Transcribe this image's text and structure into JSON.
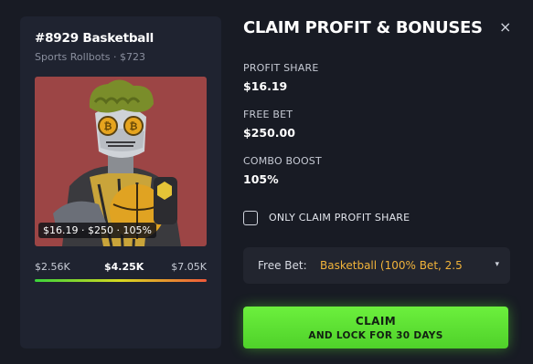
{
  "nft_card": {
    "title": "#8929 Basketball",
    "subtitle": "Sports Rollbots · $723",
    "image_badge": "$16.19 · $250 · 105%",
    "scale": {
      "low": "$2.56K",
      "mid": "$4.25K",
      "high": "$7.05K"
    },
    "colors": {
      "art_background": "#9c4545",
      "gradient_start": "#3bd43b",
      "gradient_mid": "#d8d820",
      "gradient_end": "#f05a3a"
    }
  },
  "dialog": {
    "title": "CLAIM PROFIT & BONUSES",
    "close_icon": "×",
    "profit_share": {
      "label": "PROFIT SHARE",
      "value": "$16.19"
    },
    "free_bet": {
      "label": "FREE BET",
      "value": "$250.00"
    },
    "combo_boost": {
      "label": "COMBO BOOST",
      "value": "105%"
    },
    "only_profit_checkbox": {
      "label": "ONLY CLAIM PROFIT SHARE",
      "checked": false
    },
    "free_bet_select": {
      "label": "Free Bet:",
      "value": "Basketball (100% Bet, 2.5",
      "caret": "▾"
    },
    "claim_button": {
      "line1": "CLAIM",
      "line2": "AND LOCK FOR 30 DAYS"
    },
    "colors": {
      "accent_green": "#5ee032",
      "select_value": "#f1b33a",
      "background": "#181b24",
      "card": "#1f2330"
    }
  }
}
